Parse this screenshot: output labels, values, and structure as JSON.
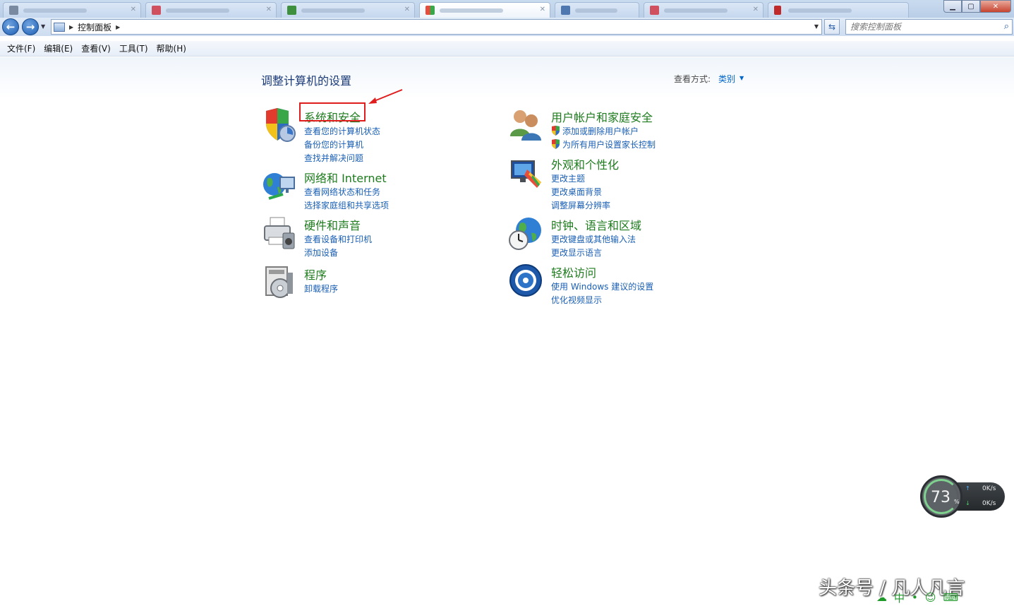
{
  "window": {
    "controls": {
      "minimize": "▁",
      "maximize": "▢",
      "close": "✕"
    }
  },
  "address_bar": {
    "breadcrumb": "控制面板",
    "search_placeholder": "搜索控制面板"
  },
  "menu": [
    "文件(F)",
    "编辑(E)",
    "查看(V)",
    "工具(T)",
    "帮助(H)"
  ],
  "main": {
    "title": "调整计算机的设置",
    "view_by_label": "查看方式:",
    "view_by_value": "类别",
    "left_categories": [
      {
        "title": "系统和安全",
        "icon": "shield-icon",
        "links": [
          "查看您的计算机状态",
          "备份您的计算机",
          "查找并解决问题"
        ]
      },
      {
        "title": "网络和 Internet",
        "icon": "network-globe-icon",
        "links": [
          "查看网络状态和任务",
          "选择家庭组和共享选项"
        ]
      },
      {
        "title": "硬件和声音",
        "icon": "printer-icon",
        "links": [
          "查看设备和打印机",
          "添加设备"
        ]
      },
      {
        "title": "程序",
        "icon": "programs-icon",
        "links": [
          "卸载程序"
        ]
      }
    ],
    "right_categories": [
      {
        "title": "用户帐户和家庭安全",
        "icon": "users-icon",
        "links": [
          "添加或删除用户帐户",
          "为所有用户设置家长控制"
        ]
      },
      {
        "title": "外观和个性化",
        "icon": "appearance-icon",
        "links": [
          "更改主题",
          "更改桌面背景",
          "调整屏幕分辨率"
        ]
      },
      {
        "title": "时钟、语言和区域",
        "icon": "clock-globe-icon",
        "links": [
          "更改键盘或其他输入法",
          "更改显示语言"
        ]
      },
      {
        "title": "轻松访问",
        "icon": "ease-of-access-icon",
        "links": [
          "使用 Windows 建议的设置",
          "优化视频显示"
        ]
      }
    ]
  },
  "speed_widget": {
    "percent": "73",
    "percent_sign": "%",
    "up_rate": "0K/s",
    "down_rate": "0K/s"
  },
  "watermark": "头条号 / 凡人凡言",
  "ime_bar": "中"
}
